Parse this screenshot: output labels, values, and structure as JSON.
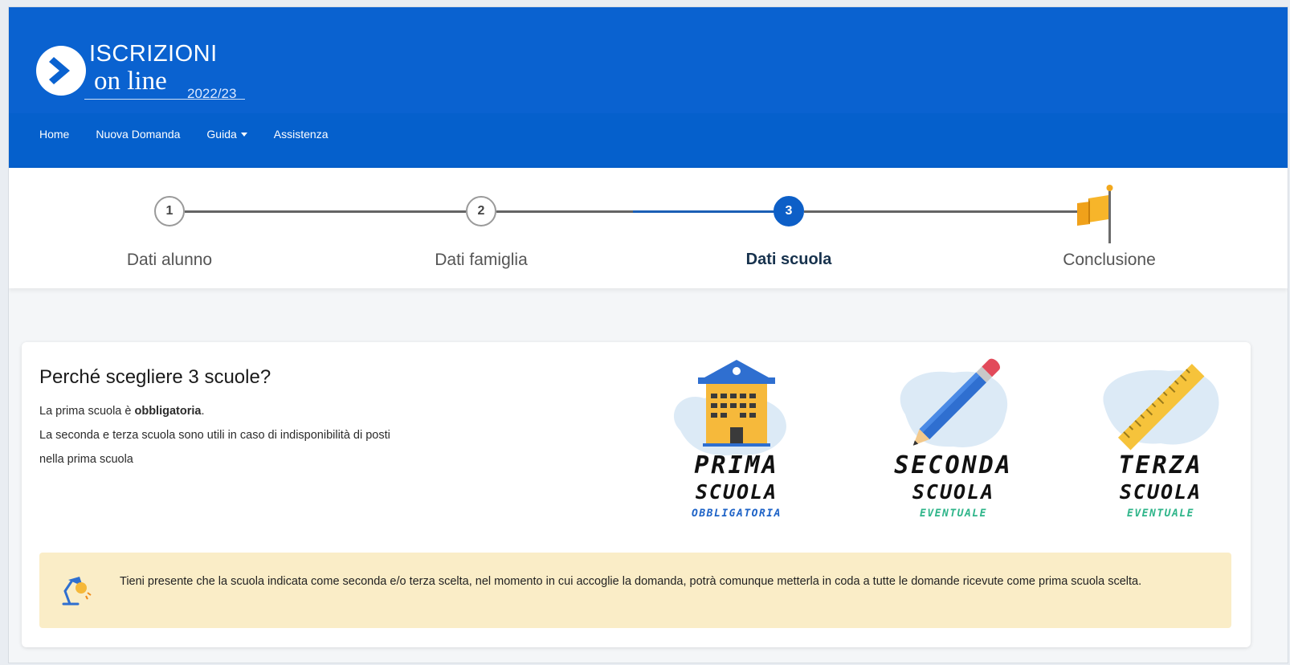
{
  "header": {
    "logo_title": "ISCRIZIONI",
    "logo_subtitle": "on line",
    "logo_year": "2022/23",
    "nav": [
      {
        "label": "Home"
      },
      {
        "label": "Nuova Domanda"
      },
      {
        "label": "Guida"
      },
      {
        "label": "Assistenza"
      }
    ]
  },
  "stepper": {
    "steps": [
      {
        "number": "1",
        "label": "Dati alunno",
        "state": "done"
      },
      {
        "number": "2",
        "label": "Dati famiglia",
        "state": "done"
      },
      {
        "number": "3",
        "label": "Dati scuola",
        "state": "active"
      },
      {
        "number": "",
        "label": "Conclusione",
        "state": "flag"
      }
    ]
  },
  "card": {
    "title": "Perché scegliere 3 scuole?",
    "line1_pre": "La prima scuola è ",
    "line1_bold": "obbligatoria",
    "line1_post": ".",
    "line2": "La seconda e terza scuola sono utili in caso di indisponibilità di posti",
    "line3": "nella prima scuola",
    "illustrations": [
      {
        "line1": "PRIMA",
        "line2": "SCUOLA",
        "line3": "OBBLIGATORIA",
        "icon": "school-building-icon"
      },
      {
        "line1": "SECONDA",
        "line2": "SCUOLA",
        "line3": "EVENTUALE",
        "icon": "pencil-icon"
      },
      {
        "line1": "TERZA",
        "line2": "SCUOLA",
        "line3": "EVENTUALE",
        "icon": "ruler-icon"
      }
    ],
    "notice": "Tieni presente che la scuola indicata come seconda e/o terza scelta, nel momento in cui accoglie la domanda, potrà comunque metterla in coda a tutte le domande ricevute come prima scuola scelta."
  },
  "colors": {
    "header_blue": "#0a62d0",
    "active_blue": "#0d5fc7",
    "notice_bg": "#faedc7",
    "flag_orange": "#f2a81d"
  }
}
